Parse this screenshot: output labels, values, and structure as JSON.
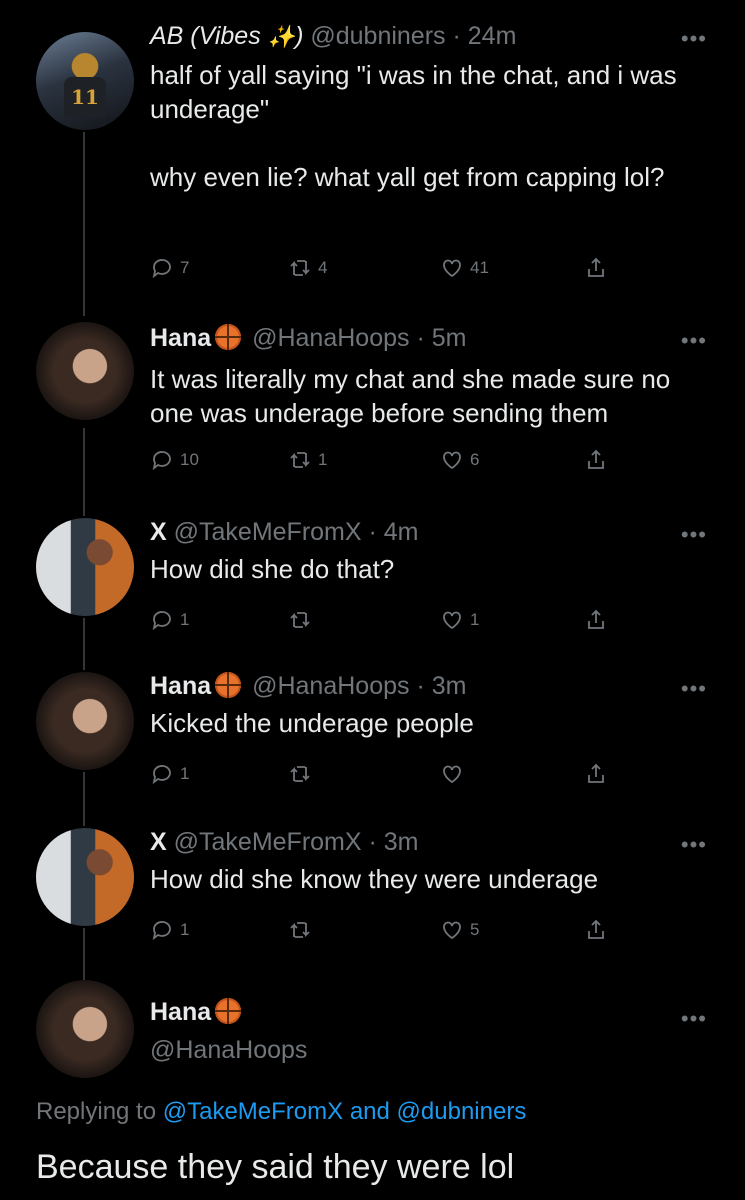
{
  "tweets": [
    {
      "name": "AB (Vibes",
      "name_suffix": ")",
      "handle_time": "@dubniners · 24m",
      "text": "half of yall saying \"i was in the chat, and i was underage\"\n\nwhy even lie? what yall get from capping lol?",
      "replies": "7",
      "retweets": "4",
      "likes": "41",
      "avatar_jersey": "11"
    },
    {
      "name": "Hana",
      "handle_time": "@HanaHoops · 5m",
      "text": "It was literally my chat and she made sure no one was underage before sending them",
      "replies": "10",
      "retweets": "1",
      "likes": "6"
    },
    {
      "name": "X",
      "handle_time": "@TakeMeFromX · 4m",
      "text": "How did she do that?",
      "replies": "1",
      "retweets": "",
      "likes": "1"
    },
    {
      "name": "Hana",
      "handle_time": "@HanaHoops · 3m",
      "text": "Kicked the underage people",
      "replies": "1",
      "retweets": "",
      "likes": ""
    },
    {
      "name": "X",
      "handle_time": "@TakeMeFromX · 3m",
      "text": "How did she know they were underage",
      "replies": "1",
      "retweets": "",
      "likes": "5"
    }
  ],
  "main": {
    "name": "Hana",
    "handle": "@HanaHoops",
    "replying_prefix": "Replying to ",
    "mention1": "@TakeMeFromX",
    "and": " and ",
    "mention2": "@dubniners",
    "text": "Because they said they were lol"
  },
  "more_label": "•••",
  "colors": {
    "background": "#000000",
    "text": "#e7e9ea",
    "muted": "#71767b",
    "link": "#1d9bf0",
    "thread_line": "#333639"
  },
  "icons": [
    "reply-icon",
    "retweet-icon",
    "like-icon",
    "share-icon",
    "basketball-emoji",
    "sparkles-emoji",
    "more-icon"
  ]
}
